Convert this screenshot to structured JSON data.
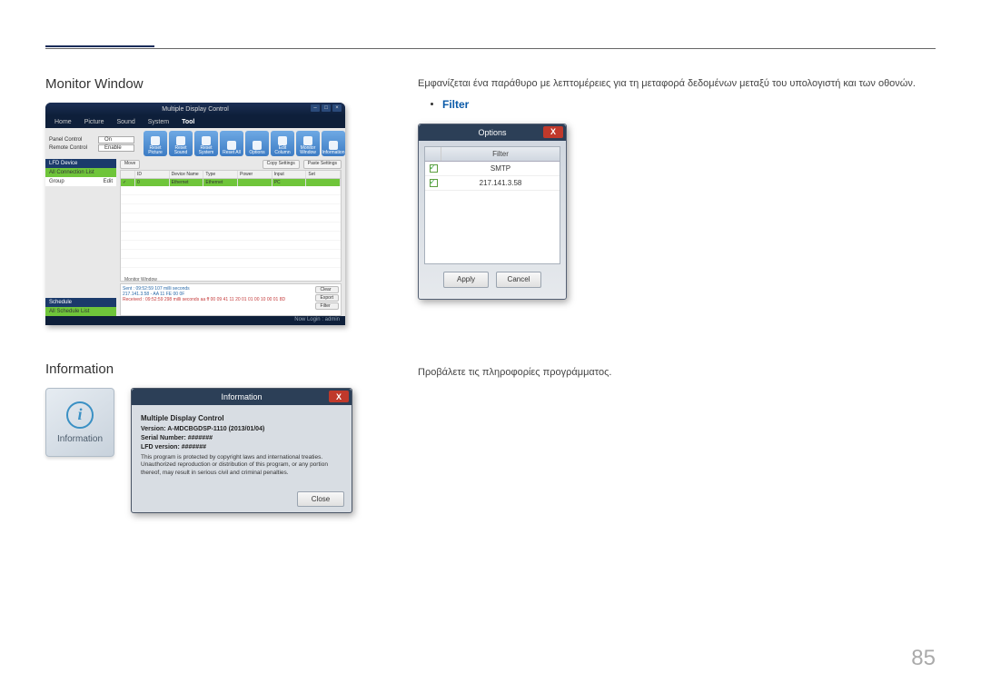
{
  "page_number": "85",
  "monitor": {
    "heading": "Monitor Window",
    "description": "Εμφανίζεται ένα παράθυρο με λεπτομέρειες για τη μεταφορά δεδομένων μεταξύ του υπολογιστή και των οθονών.",
    "filter_label": "Filter",
    "app": {
      "title": "Multiple Display Control",
      "menu": [
        "Home",
        "Picture",
        "Sound",
        "System",
        "Tool"
      ],
      "panel_control_label": "Panel Control",
      "panel_control_value": "On",
      "remote_control_label": "Remote Control",
      "remote_control_value": "Enable",
      "tool_icons": [
        "Reset Picture",
        "Reset Sound",
        "Reset System",
        "Reset All",
        "Options",
        "Edit Column",
        "Monitor Window",
        "Information"
      ],
      "side": {
        "lfd_header": "LFD Device",
        "all_conn": "All Connection List",
        "group_label": "Group",
        "group_edit": "Edit",
        "sched_header": "Schedule",
        "all_sched": "All Schedule List"
      },
      "main_buttons": [
        "Move",
        "Copy Settings",
        "Paste Settings"
      ],
      "columns": [
        "ID",
        "Device Name",
        "Type",
        "Power",
        "Input",
        "Set"
      ],
      "row": {
        "id": "0",
        "name": "Ethernet",
        "type": "Ethernet",
        "power": "",
        "input": "PC",
        "set": ""
      },
      "monitor_window_label": "Monitor Window",
      "log_sent1": "Sent : 09:52:59 107 milli seconds",
      "log_sent2": "217.141.3.58 - AA 11 FE 00 0F",
      "log_recv": "Received : 09:52:59 298 milli seconds  aa ff 00 09 41 11 20 01 01 00 10 00 01 8D",
      "log_buttons": [
        "Clear",
        "Export",
        "Filter"
      ],
      "status": "Now Login : admin"
    },
    "options_dialog": {
      "title": "Options",
      "column_header": "Filter",
      "rows": [
        "SMTP",
        "217.141.3.58"
      ],
      "apply": "Apply",
      "cancel": "Cancel"
    }
  },
  "information": {
    "heading": "Information",
    "description": "Προβάλετε τις πληροφορίες προγράμματος.",
    "tile_caption": "Information",
    "dialog": {
      "title": "Information",
      "product": "Multiple Display Control",
      "version_label": "Version: A-MDCBGDSP-1110 (2013/01/04)",
      "serial_label": "Serial Number: #######",
      "lfd_label": "LFD version: #######",
      "legal": "This program is protected by copyright laws and international treaties. Unauthorized reproduction or distribution of this program, or any portion thereof, may result in serious civil and criminal penalties.",
      "close": "Close"
    }
  }
}
